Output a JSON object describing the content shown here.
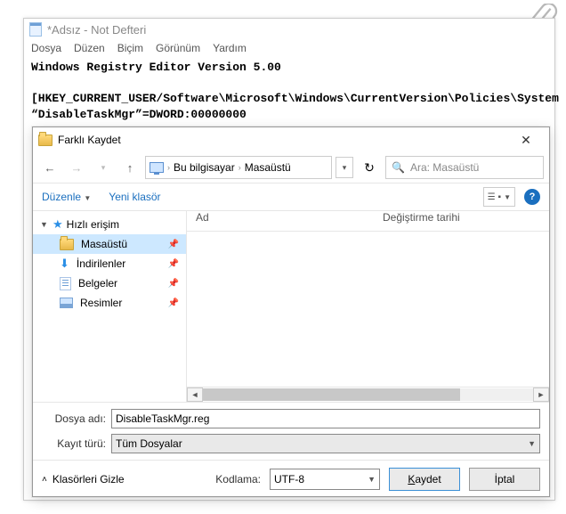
{
  "notepad": {
    "title": "*Adsız - Not Defteri",
    "menu": [
      "Dosya",
      "Düzen",
      "Biçim",
      "Görünüm",
      "Yardım"
    ],
    "content_line1": "Windows Registry Editor Version 5.00",
    "content_line2": "[HKEY_CURRENT_USER/Software\\Microsoft\\Windows\\CurrentVersion\\Policies\\System",
    "content_line3": "“DisableTaskMgr”=DWORD:00000000"
  },
  "dialog": {
    "title": "Farklı Kaydet",
    "breadcrumbs": [
      "Bu bilgisayar",
      "Masaüstü"
    ],
    "search_placeholder": "Ara: Masaüstü",
    "toolbar": {
      "organize": "Düzenle",
      "newfolder": "Yeni klasör"
    },
    "tree": {
      "quick_access": "Hızlı erişim",
      "items": [
        {
          "label": "Masaüstü",
          "icon": "folder",
          "selected": true
        },
        {
          "label": "İndirilenler",
          "icon": "download",
          "selected": false
        },
        {
          "label": "Belgeler",
          "icon": "doc",
          "selected": false
        },
        {
          "label": "Resimler",
          "icon": "image",
          "selected": false
        }
      ]
    },
    "columns": {
      "name": "Ad",
      "modified": "Değiştirme tarihi"
    },
    "filename_label": "Dosya adı:",
    "filename_value": "DisableTaskMgr.reg",
    "filetype_label": "Kayıt türü:",
    "filetype_value": "Tüm Dosyalar",
    "hide_folders": "Klasörleri Gizle",
    "encoding_label": "Kodlama:",
    "encoding_value": "UTF-8",
    "save": "Kaydet",
    "cancel": "İptal"
  }
}
